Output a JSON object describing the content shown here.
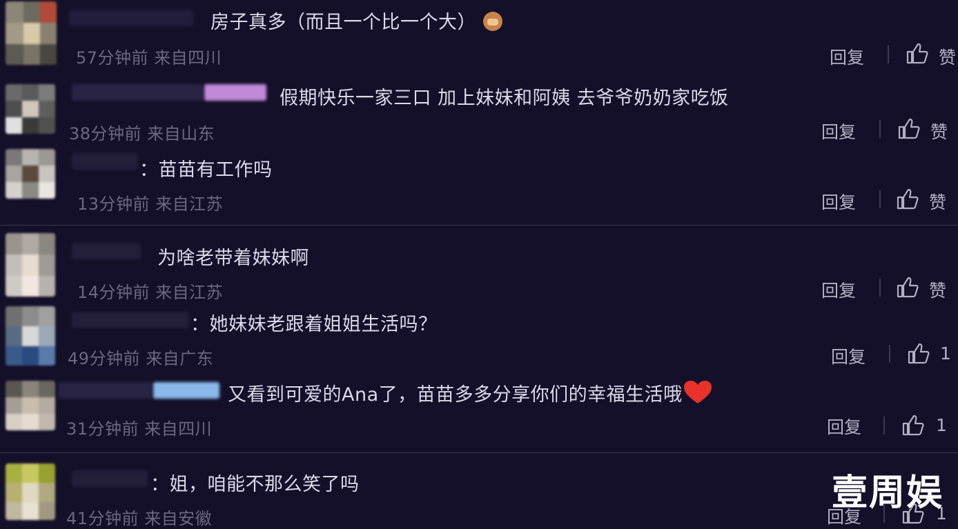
{
  "comments": [
    {
      "text": "房子真多（而且一个比一个大）",
      "emoji": "monkey",
      "time": "57分钟前",
      "location": "来自四川",
      "reply": "回复",
      "likes": "赞"
    },
    {
      "text": "假期快乐一家三口 加上妹妹和阿姨 去爷爷奶奶家吃饭",
      "time": "38分钟前",
      "location": "来自山东",
      "reply": "回复",
      "likes": "赞"
    },
    {
      "text": "：苗苗有工作吗",
      "time": "13分钟前",
      "location": "来自江苏",
      "reply": "回复",
      "likes": "赞"
    },
    {
      "text": "为啥老带着妹妹啊",
      "time": "14分钟前",
      "location": "来自江苏",
      "reply": "回复",
      "likes": "赞"
    },
    {
      "text": "：她妹妹老跟着姐姐生活吗？",
      "time": "49分钟前",
      "location": "来自广东",
      "reply": "回复",
      "likes": "1"
    },
    {
      "text": "又看到可爱的Ana了，苗苗多多分享你们的幸福生活哦",
      "emoji": "heart",
      "time": "31分钟前",
      "location": "来自四川",
      "reply": "回复",
      "likes": "1"
    },
    {
      "text": "：姐，咱能不那么笑了吗",
      "time": "41分钟前",
      "location": "来自安徽",
      "reply": "回复",
      "likes": "1"
    }
  ],
  "watermark": "壹周娱",
  "colors": {
    "background": "#14102a",
    "text": "#dcd9ea",
    "meta": "#6c6882",
    "action": "#b3b0c4"
  }
}
